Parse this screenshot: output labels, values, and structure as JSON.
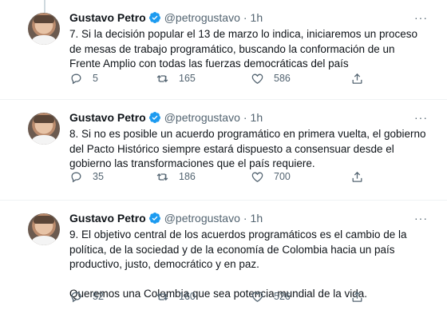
{
  "tweets": [
    {
      "author_name": "Gustavo Petro",
      "handle": "@petrogustavo",
      "separator": "·",
      "time": "1h",
      "more": "···",
      "paragraphs": [
        "7. Si la decisión popular el 13 de marzo lo indica, iniciaremos un proceso de mesas de trabajo programático, buscando la conformación de un Frente Amplio con todas las fuerzas democráticas del país"
      ],
      "replies": "5",
      "retweets": "165",
      "likes": "586"
    },
    {
      "author_name": "Gustavo Petro",
      "handle": "@petrogustavo",
      "separator": "·",
      "time": "1h",
      "more": "···",
      "paragraphs": [
        "8. Si no es posible un acuerdo programático en primera vuelta, el gobierno del Pacto Histórico siempre estará dispuesto a consensuar desde el gobierno las transformaciones que el país requiere."
      ],
      "replies": "35",
      "retweets": "186",
      "likes": "700"
    },
    {
      "author_name": "Gustavo Petro",
      "handle": "@petrogustavo",
      "separator": "·",
      "time": "1h",
      "more": "···",
      "paragraphs": [
        "9. El objetivo central de los acuerdos programáticos es el cambio de la política, de la sociedad y de la economía de Colombia hacia un país productivo, justo, democrático y en paz.",
        "Queremos una Colombia que sea potencia mundial de la vida."
      ],
      "replies": "52",
      "retweets": "160",
      "likes": "526"
    }
  ],
  "icons": {
    "verified": "verified-badge-icon",
    "reply": "reply-bubble-icon",
    "retweet": "retweet-icon",
    "like": "heart-icon",
    "share": "share-icon"
  },
  "colors": {
    "verified": "#1d9bf0",
    "text": "#0f1419",
    "secondary": "#536471",
    "divider": "#eff3f4"
  }
}
